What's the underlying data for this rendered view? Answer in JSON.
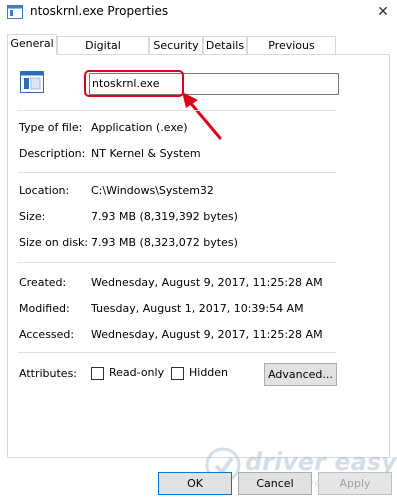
{
  "window": {
    "title": "ntoskrnl.exe Properties",
    "close_glyph": "✕"
  },
  "tabs": [
    {
      "label": "General",
      "active": true
    },
    {
      "label": "Digital Signatures",
      "active": false
    },
    {
      "label": "Security",
      "active": false
    },
    {
      "label": "Details",
      "active": false
    },
    {
      "label": "Previous Versions",
      "active": false
    }
  ],
  "general": {
    "file_name": "ntoskrnl.exe",
    "type_label": "Type of file:",
    "type_value": "Application (.exe)",
    "description_label": "Description:",
    "description_value": "NT Kernel & System",
    "location_label": "Location:",
    "location_value": "C:\\Windows\\System32",
    "size_label": "Size:",
    "size_value": "7.93 MB (8,319,392 bytes)",
    "size_on_disk_label": "Size on disk:",
    "size_on_disk_value": "7.93 MB (8,323,072 bytes)",
    "created_label": "Created:",
    "created_value": "Wednesday, August 9, 2017, 11:25:28 AM",
    "modified_label": "Modified:",
    "modified_value": "Tuesday, August 1, 2017, 10:39:54 AM",
    "accessed_label": "Accessed:",
    "accessed_value": "Wednesday, August 9, 2017, 11:25:28 AM",
    "attributes_label": "Attributes:",
    "readonly_label": "Read-only",
    "readonly_checked": false,
    "hidden_label": "Hidden",
    "hidden_checked": false,
    "advanced_label": "Advanced..."
  },
  "buttons": {
    "ok": "OK",
    "cancel": "Cancel",
    "apply": "Apply"
  },
  "watermark": {
    "brand": "driver easy",
    "url": "www.DriverEasy.com"
  },
  "colors": {
    "highlight": "#e0001b",
    "accent": "#0078d7"
  }
}
